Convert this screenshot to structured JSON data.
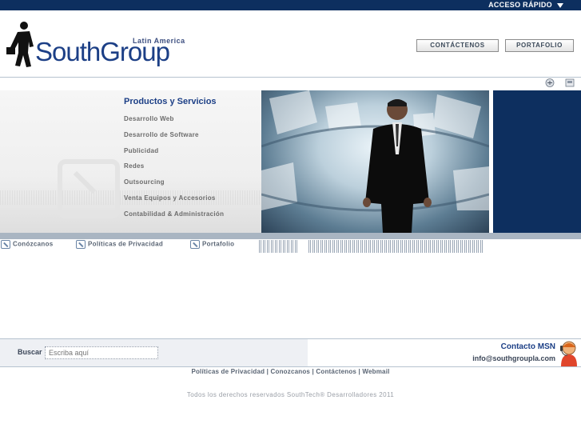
{
  "topbar": {
    "quick_access": "ACCESO RÁPIDO"
  },
  "logo": {
    "south": "South",
    "group": "Group",
    "tagline": "Latin America"
  },
  "header_buttons": {
    "contact": "CONTÁCTENOS",
    "portfolio": "PORTAFOLIO"
  },
  "toolbar": {
    "icons": [
      "print-icon",
      "save-icon"
    ]
  },
  "products": {
    "title": "Productos y Servicios",
    "items": [
      "Desarrollo Web",
      "Desarrollo de Software",
      "Publicidad",
      "Redes",
      "Outsourcing",
      "Venta Equipos y Accesorios",
      "Contabilidad & Administración"
    ]
  },
  "quick_links": [
    {
      "label": "Conózcanos",
      "icon": "arrow-box-icon"
    },
    {
      "label": "Políticas de Privacidad",
      "icon": "arrow-box-icon"
    },
    {
      "label": "Portafolio",
      "icon": "arrow-box-icon"
    }
  ],
  "search": {
    "label": "Buscar",
    "placeholder": "Escriba aquí"
  },
  "msn": {
    "title": "Contacto MSN",
    "email": "info@southgroupla.com",
    "icon": "msn-messenger-icon"
  },
  "footer": {
    "links": [
      "Políticas de Privacidad",
      "Conozcanos",
      "Contáctenos",
      "Webmail"
    ],
    "separator": "|",
    "copyright": "Todos los derechos reservados SouthTech® Desarrolladores 2011"
  },
  "colors": {
    "navy": "#0d2f5f",
    "brand_blue": "#1c3f86",
    "grey_bar": "#a9b5c2"
  }
}
